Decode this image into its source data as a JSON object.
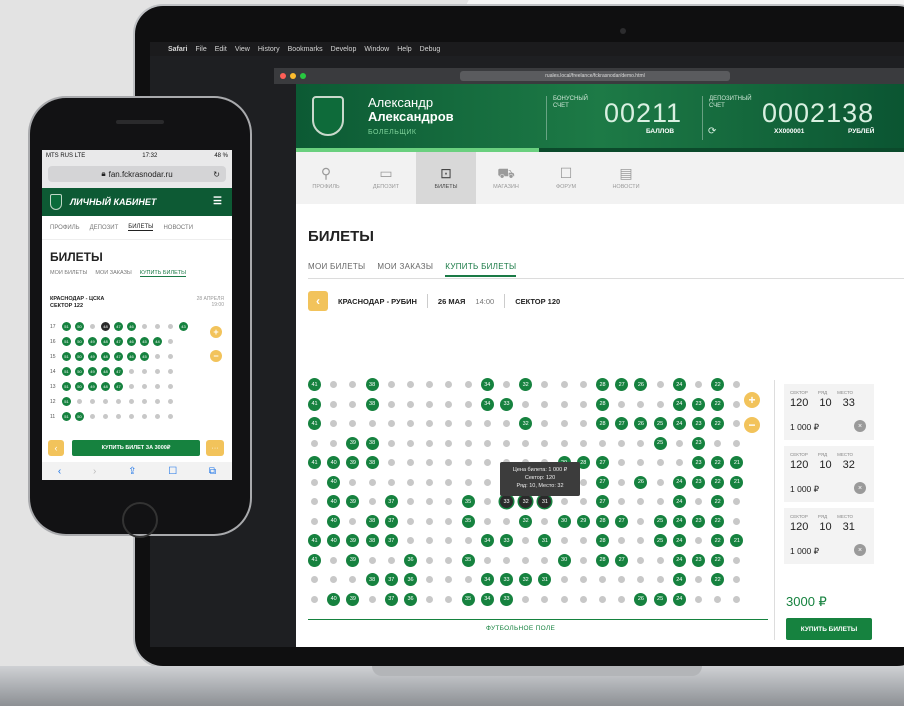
{
  "mac_menu": {
    "apple": "",
    "items": [
      "Safari",
      "File",
      "Edit",
      "View",
      "History",
      "Bookmarks",
      "Develop",
      "Window",
      "Help",
      "Debug"
    ]
  },
  "browser": {
    "url": "ruales.local/freelance/fckrasnodar/demo.html"
  },
  "header": {
    "first_name": "Александр",
    "last_name": "Александров",
    "role": "БОЛЕЛЬЩИК",
    "bonus_label": "БОНУСНЫЙ СЧЕТ",
    "bonus_value": "00211",
    "bonus_unit": "БАЛЛОВ",
    "deposit_label": "ДЕПОЗИТНЫЙ СЧЕТ",
    "deposit_value": "0002138",
    "deposit_account": "XX000001",
    "deposit_unit": "РУБЛЕЙ",
    "progress_fraction": 0.4,
    "colors": {
      "header_green": "#0c5a34",
      "accent_green": "#16823f",
      "accent_yellow": "#f2c35b"
    }
  },
  "nav": [
    {
      "label": "ПРОФИЛЬ",
      "icon": "profile-icon",
      "glyph": "⚲"
    },
    {
      "label": "ДЕПОЗИТ",
      "icon": "wallet-icon",
      "glyph": "▭"
    },
    {
      "label": "БИЛЕТЫ",
      "icon": "ticket-icon",
      "glyph": "⊡",
      "active": true
    },
    {
      "label": "МАГАЗИН",
      "icon": "cart-icon",
      "glyph": "⛟"
    },
    {
      "label": "ФОРУМ",
      "icon": "forum-icon",
      "glyph": "☐"
    },
    {
      "label": "НОВОСТИ",
      "icon": "news-icon",
      "glyph": "▤"
    }
  ],
  "tickets": {
    "title": "БИЛЕТЫ",
    "tabs": [
      "МОИ БИЛЕТЫ",
      "МОИ ЗАКАЗЫ",
      "КУПИТЬ БИЛЕТЫ"
    ],
    "active_tab": 2,
    "match": "КРАСНОДАР - РУБИН",
    "date": "26 МАЯ",
    "time": "14:00",
    "sector": "СЕКТОР 120",
    "tooltip": {
      "line1": "Цена билета: 1 000 ₽",
      "line2": "Сектор: 120",
      "line3": "Ряд: 10, Место: 32"
    },
    "field_label": "ФУТБОЛЬНОЕ ПОЛЕ",
    "seat_rows": [
      "41 . . 38 . . . . . 34 . 32 . . . 28 27 26 . 24 . 22 .",
      "41 . . 38 . . . . . 34 33 . . . . 28 . . . 24 23 22 .",
      "41 . . . . . . . . . . 32 . . . 28 27 26 25 24 23 22 .",
      ". . 39 38 . . . . . . . . . . . . . . 25 . 23 . .",
      "41 40 39 38 . . . . . . . . . 29 28 27 . . . . 23 22 21",
      ". 40 . . . . . . . . . . . . . 27 . 26 . 24 23 22 21",
      ". 40 39 . 37 . . . 35 . 33 32 31 . . 27 . . . 24 . 22 .",
      ". 40 . 38 37 . . . 35 . . 32 . 30 29 28 27 . 25 24 23 22 .",
      "41 40 39 38 37 . . . . 34 33 . 31 . . 28 . . 25 24 . 22 21",
      "41 . 39 . . 36 . . 35 . . . . 30 . 28 27 . . 24 23 22 .",
      ". . . 38 37 36 . . . 34 33 32 31 . . . . . . 24 . 22 .",
      ". 40 39 . 37 36 . . 35 34 33 . . . . . . 26 25 24 . . ."
    ],
    "selected_seats": [
      {
        "row": 6,
        "seat": "33"
      },
      {
        "row": 6,
        "seat": "32"
      },
      {
        "row": 6,
        "seat": "31"
      }
    ],
    "cart_labels": {
      "sector": "СЕКТОР",
      "row": "РЯД",
      "seat": "МЕСТО"
    },
    "cart": [
      {
        "sector": "120",
        "row": "10",
        "seat": "33",
        "price": "1 000 ₽"
      },
      {
        "sector": "120",
        "row": "10",
        "seat": "32",
        "price": "1 000 ₽"
      },
      {
        "sector": "120",
        "row": "10",
        "seat": "31",
        "price": "1 000 ₽"
      }
    ],
    "total": "3000 ₽",
    "buy_label": "КУПИТЬ БИЛЕТЫ"
  },
  "phone": {
    "status_left": "MTS RUS  LTE",
    "status_time": "17:32",
    "status_right": "48 %",
    "url": "fan.fckrasnodar.ru",
    "header_title": "ЛИЧНЫЙ КАБИНЕТ",
    "nav": [
      "ПРОФИЛЬ",
      "ДЕПОЗИТ",
      "БИЛЕТЫ",
      "НОВОСТИ"
    ],
    "nav_active": 2,
    "title": "БИЛЕТЫ",
    "tabs": [
      "МОИ БИЛЕТЫ",
      "МОИ ЗАКАЗЫ",
      "КУПИТЬ БИЛЕТЫ"
    ],
    "match_line1": "КРАСНОДАР - ЦСКА",
    "match_line2": "СЕКТОР 122",
    "date": "28 АПРЕЛЯ",
    "date_sub": "19:00",
    "rows": [
      {
        "no": "17",
        "seats": "51 50 . 48 47 46 . . . 43"
      },
      {
        "no": "16",
        "seats": "51 50 49 48 47 46 45 44 ."
      },
      {
        "no": "15",
        "seats": "51 50 49 48 47 46 45 . ."
      },
      {
        "no": "14",
        "seats": "51 50 49 48 47 . . . ."
      },
      {
        "no": "13",
        "seats": "51 50 49 48 47 . . . ."
      },
      {
        "no": "12",
        "seats": "51 . . . . . . . ."
      },
      {
        "no": "11",
        "seats": "51 50 . . . . . . ."
      }
    ],
    "buy_label": "КУПИТЬ БИЛЕТ ЗА 3000₽"
  }
}
